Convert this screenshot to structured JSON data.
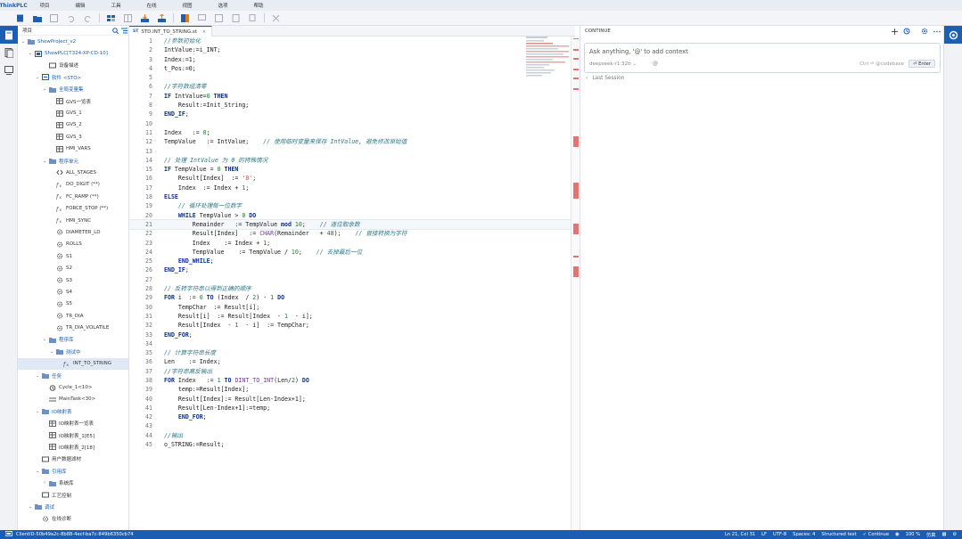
{
  "menubar": {
    "logo": "ThinkPLC",
    "items": [
      "项目",
      "编辑",
      "工具",
      "在线",
      "视图",
      "选项",
      "帮助"
    ]
  },
  "tree": {
    "title": "项目",
    "rows": [
      {
        "label": "ShowProject_v2",
        "indent": 0,
        "chev": "v",
        "icon": "folder",
        "blue": true
      },
      {
        "label": "ShowPLC[T324-XP-CD-10]",
        "indent": 1,
        "chev": "v",
        "icon": "plc",
        "blue": true
      },
      {
        "label": "设备描述",
        "indent": 3,
        "chev": "",
        "icon": "device",
        "blue": false
      },
      {
        "label": "软件 <STO>",
        "indent": 2,
        "chev": "v",
        "icon": "software",
        "blue": true
      },
      {
        "label": "全局变量集",
        "indent": 3,
        "chev": "v",
        "icon": "folder",
        "blue": true
      },
      {
        "label": "GVS一览表",
        "indent": 4,
        "chev": "",
        "icon": "table",
        "blue": false
      },
      {
        "label": "GVS_1",
        "indent": 4,
        "chev": "",
        "icon": "table",
        "blue": false
      },
      {
        "label": "GVS_2",
        "indent": 4,
        "chev": "",
        "icon": "table",
        "blue": false
      },
      {
        "label": "GVS_3",
        "indent": 4,
        "chev": "",
        "icon": "table",
        "blue": false
      },
      {
        "label": "HMI_VARS",
        "indent": 4,
        "chev": "",
        "icon": "table",
        "blue": false
      },
      {
        "label": "程序单元",
        "indent": 3,
        "chev": "v",
        "icon": "folder",
        "blue": true
      },
      {
        "label": "ALL_STAGES",
        "indent": 4,
        "chev": "",
        "icon": "code",
        "blue": false
      },
      {
        "label": "DO_DIGIT (**)",
        "indent": 4,
        "chev": "",
        "icon": "fx",
        "blue": false
      },
      {
        "label": "FC_RAMP (**)",
        "indent": 4,
        "chev": "",
        "icon": "fx",
        "blue": false
      },
      {
        "label": "FORCE_STOP (**)",
        "indent": 4,
        "chev": "",
        "icon": "fx",
        "blue": false
      },
      {
        "label": "HMI_SYNC",
        "indent": 4,
        "chev": "",
        "icon": "fx",
        "blue": false
      },
      {
        "label": "DIAMETER_LD",
        "indent": 4,
        "chev": "",
        "icon": "gear",
        "blue": false
      },
      {
        "label": "ROLLS",
        "indent": 4,
        "chev": "",
        "icon": "gear",
        "blue": false
      },
      {
        "label": "S1",
        "indent": 4,
        "chev": "",
        "icon": "gear",
        "blue": false
      },
      {
        "label": "S2",
        "indent": 4,
        "chev": "",
        "icon": "gear",
        "blue": false
      },
      {
        "label": "S3",
        "indent": 4,
        "chev": "",
        "icon": "gear",
        "blue": false
      },
      {
        "label": "S4",
        "indent": 4,
        "chev": "",
        "icon": "gear",
        "blue": false
      },
      {
        "label": "S5",
        "indent": 4,
        "chev": "",
        "icon": "gear",
        "blue": false
      },
      {
        "label": "TR_DIA",
        "indent": 4,
        "chev": "",
        "icon": "gear",
        "blue": false
      },
      {
        "label": "TR_DIA_VOLATILE",
        "indent": 4,
        "chev": "",
        "icon": "gear",
        "blue": false
      },
      {
        "label": "程序库",
        "indent": 3,
        "chev": "v",
        "icon": "folder",
        "blue": true
      },
      {
        "label": "测试中",
        "indent": 4,
        "chev": "v",
        "icon": "folder",
        "blue": true
      },
      {
        "label": "INT_TO_STRING",
        "indent": 5,
        "chev": "",
        "icon": "fx",
        "blue": false,
        "selected": true
      },
      {
        "label": "任务",
        "indent": 2,
        "chev": "v",
        "icon": "folder",
        "blue": true
      },
      {
        "label": "Cycle_1<10>",
        "indent": 3,
        "chev": "",
        "icon": "clock",
        "blue": false
      },
      {
        "label": "MainTask<30>",
        "indent": 3,
        "chev": "",
        "icon": "task",
        "blue": false
      },
      {
        "label": "IO映射表",
        "indent": 2,
        "chev": "v",
        "icon": "folder",
        "blue": true
      },
      {
        "label": "IO映射表一览表",
        "indent": 3,
        "chev": "",
        "icon": "table",
        "blue": false
      },
      {
        "label": "IO映射表_1[E5]",
        "indent": 3,
        "chev": "",
        "icon": "table",
        "blue": false
      },
      {
        "label": "IO映射表_2[18]",
        "indent": 3,
        "chev": "",
        "icon": "table",
        "blue": false
      },
      {
        "label": "用户数据滤材",
        "indent": 2,
        "chev": "",
        "icon": "device",
        "blue": false
      },
      {
        "label": "引用库",
        "indent": 2,
        "chev": "v",
        "icon": "folder",
        "blue": true
      },
      {
        "label": "系统库",
        "indent": 3,
        "chev": ">",
        "icon": "folder",
        "blue": false
      },
      {
        "label": "工艺控制",
        "indent": 2,
        "chev": "",
        "icon": "device",
        "blue": false
      },
      {
        "label": "调试",
        "indent": 1,
        "chev": "v",
        "icon": "folder",
        "blue": true
      },
      {
        "label": "在线诊断",
        "indent": 2,
        "chev": "",
        "icon": "gear",
        "blue": false
      }
    ]
  },
  "editor": {
    "tab_label": "STD.INT_TO_STRING.st",
    "tab_prefix": "ST",
    "current_line": 21,
    "lines": [
      [
        [
          "cm",
          "//参数初始化"
        ]
      ],
      [
        [
          "op",
          "IntValue:=i_INT;"
        ]
      ],
      [
        [
          "op",
          "Index:=1;"
        ]
      ],
      [
        [
          "op",
          "t_Pos:=0;"
        ]
      ],
      [],
      [
        [
          "cm",
          "//字符数组清零"
        ]
      ],
      [
        [
          "kw",
          "IF"
        ],
        [
          "op",
          " IntValue="
        ],
        [
          "num",
          "0"
        ],
        [
          "kw",
          " THEN"
        ]
      ],
      [
        [
          "op",
          "    Result:=Init_String;"
        ]
      ],
      [
        [
          "kw",
          "END_IF"
        ],
        [
          "op",
          ";"
        ]
      ],
      [],
      [
        [
          "op",
          "Index   := "
        ],
        [
          "num",
          "0"
        ],
        [
          "op",
          ";"
        ]
      ],
      [
        [
          "op",
          "TempValue   := IntValue;    "
        ],
        [
          "cm",
          "// 使用临时变量来保存 IntValue, 避免修改原始值"
        ]
      ],
      [],
      [
        [
          "cm",
          "// 处理 IntValue 为 0 的特殊情况"
        ]
      ],
      [
        [
          "kw",
          "IF"
        ],
        [
          "op",
          " TempValue = "
        ],
        [
          "num",
          "0"
        ],
        [
          "kw",
          " THEN"
        ]
      ],
      [
        [
          "op",
          "    Result[Index]  := "
        ],
        [
          "str",
          "'0'"
        ],
        [
          "op",
          ";"
        ]
      ],
      [
        [
          "op",
          "    Index  := Index + "
        ],
        [
          "num",
          "1"
        ],
        [
          "op",
          ";"
        ]
      ],
      [
        [
          "kw",
          "ELSE"
        ]
      ],
      [
        [
          "cm",
          "    // 循环处理每一位数字"
        ]
      ],
      [
        [
          "kw",
          "    WHILE"
        ],
        [
          "op",
          " TempValue > "
        ],
        [
          "num",
          "0"
        ],
        [
          "kw",
          " DO"
        ]
      ],
      [
        [
          "op",
          "        Remainder   := TempValue "
        ],
        [
          "kw",
          "mod"
        ],
        [
          "op",
          " "
        ],
        [
          "num",
          "10"
        ],
        [
          "op",
          ";    "
        ],
        [
          "cm",
          "// 逐位取余数"
        ]
      ],
      [
        [
          "op",
          "        Result[Index]   := "
        ],
        [
          "fn",
          "CHAR"
        ],
        [
          "op",
          "(Remainder   + "
        ],
        [
          "num",
          "48"
        ],
        [
          "op",
          ");    "
        ],
        [
          "cm",
          "// 直接转换为字符"
        ]
      ],
      [
        [
          "op",
          "        Index    := Index + "
        ],
        [
          "num",
          "1"
        ],
        [
          "op",
          ";"
        ]
      ],
      [
        [
          "op",
          "        TempValue    := TempValue / "
        ],
        [
          "num",
          "10"
        ],
        [
          "op",
          ";    "
        ],
        [
          "cm",
          "// 去掉最后一位"
        ]
      ],
      [
        [
          "kw",
          "    END_WHILE"
        ],
        [
          "op",
          ";"
        ]
      ],
      [
        [
          "kw",
          "END_IF"
        ],
        [
          "op",
          ";"
        ]
      ],
      [],
      [
        [
          "cm",
          "// 反转字符串以得到正确的顺序"
        ]
      ],
      [
        [
          "kw",
          "FOR"
        ],
        [
          "op",
          " i  := "
        ],
        [
          "num",
          "0"
        ],
        [
          "kw",
          " TO"
        ],
        [
          "op",
          " (Index  / "
        ],
        [
          "num",
          "2"
        ],
        [
          "op",
          ") - "
        ],
        [
          "num",
          "1"
        ],
        [
          "kw",
          " DO"
        ]
      ],
      [
        [
          "op",
          "    TempChar  := Result[i];"
        ]
      ],
      [
        [
          "op",
          "    Result[i]  := Result[Index  - "
        ],
        [
          "num",
          "1"
        ],
        [
          "op",
          "  - i];"
        ]
      ],
      [
        [
          "op",
          "    Result[Index  - "
        ],
        [
          "num",
          "1"
        ],
        [
          "op",
          "  - i]  := TempChar;"
        ]
      ],
      [
        [
          "kw",
          "END_FOR"
        ],
        [
          "op",
          ";"
        ]
      ],
      [],
      [
        [
          "cm",
          "// 计算字符串长度"
        ]
      ],
      [
        [
          "op",
          "Len    := Index;"
        ]
      ],
      [
        [
          "cm",
          "//字符串高反输出"
        ]
      ],
      [
        [
          "kw",
          "FOR"
        ],
        [
          "op",
          " Index   := "
        ],
        [
          "num",
          "1"
        ],
        [
          "kw",
          " TO"
        ],
        [
          "op",
          " "
        ],
        [
          "fn",
          "DINT_TO_INT"
        ],
        [
          "op",
          "(Len/"
        ],
        [
          "num",
          "2"
        ],
        [
          "op",
          ")"
        ],
        [
          "kw",
          " DO"
        ]
      ],
      [
        [
          "op",
          "    temp:=Result[Index];"
        ]
      ],
      [
        [
          "op",
          "    Result[Index]:= Result[Len-Index+1];"
        ]
      ],
      [
        [
          "op",
          "    Result[Len-Index+1]:=temp;"
        ]
      ],
      [
        [
          "kw",
          "    END_FOR"
        ],
        [
          "op",
          ";"
        ]
      ],
      [],
      [
        [
          "cm",
          "//输出"
        ]
      ],
      [
        [
          "op",
          "o_STRING:=Result;"
        ]
      ]
    ]
  },
  "continue": {
    "title": "CONTINUE",
    "placeholder": "Ask anything, '@' to add context",
    "model": "deepseek-r1:32b",
    "at": "@",
    "ctrl_hint": "Ctrl ⏎ @codebase",
    "enter_label": "⏎ Enter",
    "last_session": "Last Session"
  },
  "status": {
    "client_id": "ClientID-50b49a2c-8b88-4ecf-ba7c-849b6350cb74",
    "position": "Ln 21, Col 31",
    "eol": "LF",
    "encoding": "UTF-8",
    "spaces": "Spaces: 4",
    "language": "Structured text",
    "continue": "✓ Continue",
    "zoom": "100 %",
    "lang_mode": "仿真"
  },
  "colors": {
    "accent": "#1a5fb4",
    "statusbar": "#1c5db4",
    "ruler_error": "#e57373"
  }
}
